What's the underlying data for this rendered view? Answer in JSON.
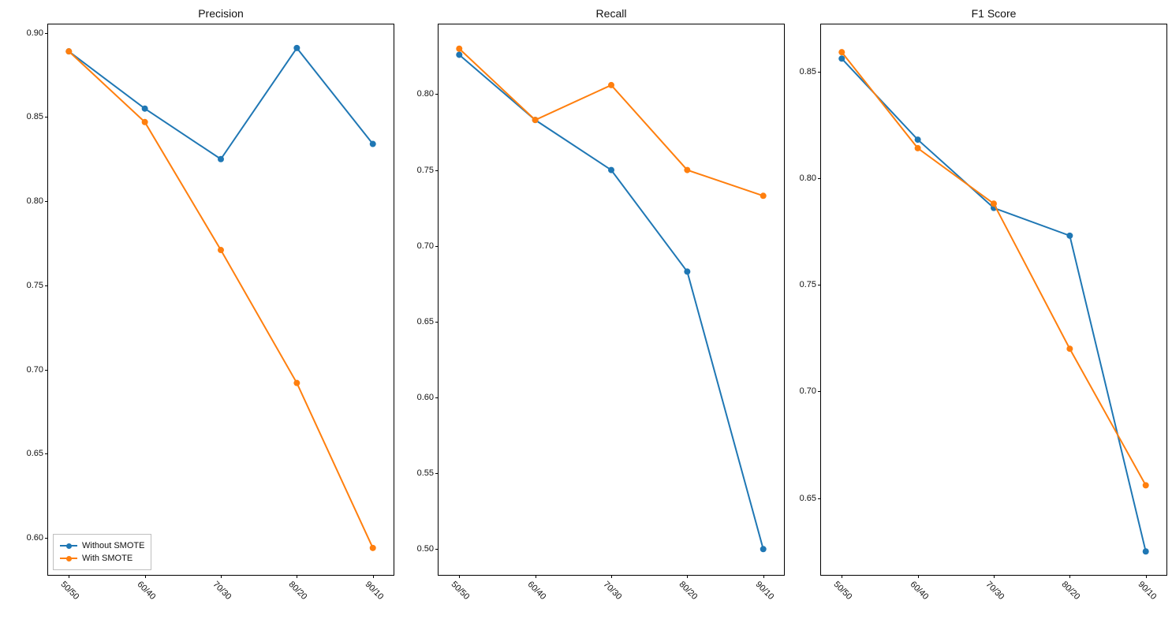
{
  "colors": {
    "without": "#1f77b4",
    "with": "#ff7f0e"
  },
  "legend": {
    "without": "Without SMOTE",
    "with": "With SMOTE"
  },
  "chart_data": [
    {
      "type": "line",
      "title": "Precision",
      "xlabel": "",
      "ylabel": "",
      "categories": [
        "50/50",
        "60/40",
        "70/30",
        "80/20",
        "90/10"
      ],
      "y_ticks": [
        0.6,
        0.65,
        0.7,
        0.75,
        0.8,
        0.85,
        0.9
      ],
      "ylim": [
        0.578,
        0.905
      ],
      "series": [
        {
          "name": "Without SMOTE",
          "color_key": "without",
          "values": [
            0.889,
            0.855,
            0.825,
            0.891,
            0.834
          ]
        },
        {
          "name": "With SMOTE",
          "color_key": "with",
          "values": [
            0.889,
            0.847,
            0.771,
            0.692,
            0.594
          ]
        }
      ]
    },
    {
      "type": "line",
      "title": "Recall",
      "xlabel": "",
      "ylabel": "",
      "categories": [
        "50/50",
        "60/40",
        "70/30",
        "80/20",
        "90/10"
      ],
      "y_ticks": [
        0.5,
        0.55,
        0.6,
        0.65,
        0.7,
        0.75,
        0.8
      ],
      "ylim": [
        0.483,
        0.846
      ],
      "series": [
        {
          "name": "Without SMOTE",
          "color_key": "without",
          "values": [
            0.826,
            0.783,
            0.75,
            0.683,
            0.5
          ]
        },
        {
          "name": "With SMOTE",
          "color_key": "with",
          "values": [
            0.83,
            0.783,
            0.806,
            0.75,
            0.733
          ]
        }
      ]
    },
    {
      "type": "line",
      "title": "F1 Score",
      "xlabel": "",
      "ylabel": "",
      "categories": [
        "50/50",
        "60/40",
        "70/30",
        "80/20",
        "90/10"
      ],
      "y_ticks": [
        0.65,
        0.7,
        0.75,
        0.8,
        0.85
      ],
      "ylim": [
        0.614,
        0.872
      ],
      "series": [
        {
          "name": "Without SMOTE",
          "color_key": "without",
          "values": [
            0.856,
            0.818,
            0.786,
            0.773,
            0.625
          ]
        },
        {
          "name": "With SMOTE",
          "color_key": "with",
          "values": [
            0.859,
            0.814,
            0.788,
            0.72,
            0.656
          ]
        }
      ]
    }
  ]
}
